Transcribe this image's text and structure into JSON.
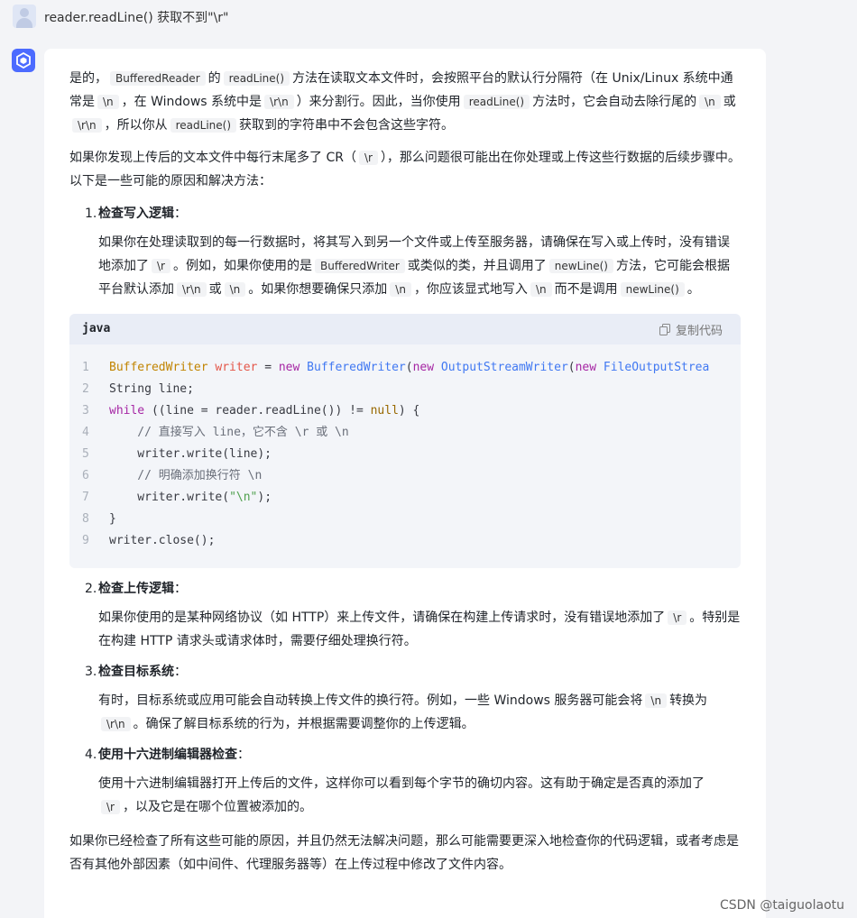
{
  "question": "reader.readLine() 获取不到\"\\r\"",
  "copy_label": "复制代码",
  "code_lang": "java",
  "p1": {
    "a": "是的，",
    "c1": "BufferedReader",
    "b": "的",
    "c2": "readLine()",
    "d": "方法在读取文本文件时，会按照平台的默认行分隔符（在 Unix/Linux 系统中通常是",
    "c3": "\\n",
    "e": "，在 Windows 系统中是",
    "c4": "\\r\\n",
    "f": "）来分割行。因此，当你使用",
    "c5": "readLine()",
    "g": "方法时，它会自动去除行尾的",
    "c6": "\\n",
    "h": "或",
    "c7": "\\r\\n",
    "i": "，所以你从",
    "c8": "readLine()",
    "j": "获取到的字符串中不会包含这些字符。"
  },
  "p2": {
    "a": "如果你发现上传后的文本文件中每行末尾多了 CR（",
    "c1": "\\r",
    "b": "），那么问题很可能出在你处理或上传这些行数据的后续步骤中。以下是一些可能的原因和解决方法："
  },
  "item1": {
    "num": "1.",
    "title": "检查写入逻辑",
    "a": "如果你在处理读取到的每一行数据时，将其写入到另一个文件或上传至服务器，请确保在写入或上传时，没有错误地添加了",
    "c1": "\\r",
    "b": "。例如，如果你使用的是",
    "c2": "BufferedWriter",
    "c": "或类似的类，并且调用了",
    "c3": "newLine()",
    "d": "方法，它可能会根据平台默认添加",
    "c4": "\\r\\n",
    "e": "或",
    "c5": "\\n",
    "f": "。如果你想要确保只添加",
    "c6": "\\n",
    "g": "，你应该显式地写入",
    "c7": "\\n",
    "h": "而不是调用",
    "c8": "newLine()",
    "i": "。"
  },
  "code_lines": [
    {
      "n": "1"
    },
    {
      "n": "2"
    },
    {
      "n": "3"
    },
    {
      "n": "4"
    },
    {
      "n": "5"
    },
    {
      "n": "6"
    },
    {
      "n": "7"
    },
    {
      "n": "8"
    },
    {
      "n": "9"
    }
  ],
  "code": {
    "l1_a": "BufferedWriter",
    "l1_b": " ",
    "l1_c": "writer",
    "l1_d": " = ",
    "l1_e": "new",
    "l1_f": " ",
    "l1_g": "BufferedWriter",
    "l1_h": "(",
    "l1_i": "new",
    "l1_j": " ",
    "l1_k": "OutputStreamWriter",
    "l1_l": "(",
    "l1_m": "new",
    "l1_n": " ",
    "l1_o": "FileOutputStrea",
    "l2": "String line;",
    "l3_a": "while",
    "l3_b": " ((line = reader.readLine()) != ",
    "l3_c": "null",
    "l3_d": ") {",
    "l4": "    // 直接写入 line，它不含 \\r 或 \\n",
    "l5": "    writer.write(line);",
    "l6": "    // 明确添加换行符 \\n",
    "l7_a": "    writer.write(",
    "l7_b": "\"\\n\"",
    "l7_c": ");",
    "l8": "}",
    "l9": "writer.close();"
  },
  "item2": {
    "num": "2.",
    "title": "检查上传逻辑",
    "a": "如果你使用的是某种网络协议（如 HTTP）来上传文件，请确保在构建上传请求时，没有错误地添加了",
    "c1": "\\r",
    "b": "。特别是在构建 HTTP 请求头或请求体时，需要仔细处理换行符。"
  },
  "item3": {
    "num": "3.",
    "title": "检查目标系统",
    "a": "有时，目标系统或应用可能会自动转换上传文件的换行符。例如，一些 Windows 服务器可能会将",
    "c1": "\\n",
    "b": "转换为",
    "c2": "\\r\\n",
    "c": "。确保了解目标系统的行为，并根据需要调整你的上传逻辑。"
  },
  "item4": {
    "num": "4.",
    "title": "使用十六进制编辑器检查",
    "a": "使用十六进制编辑器打开上传后的文件，这样你可以看到每个字节的确切内容。这有助于确定是否真的添加了",
    "c1": "\\r",
    "b": "，以及它是在哪个位置被添加的。"
  },
  "p3": "如果你已经检查了所有这些可能的原因，并且仍然无法解决问题，那么可能需要更深入地检查你的代码逻辑，或者考虑是否有其他外部因素（如中间件、代理服务器等）在上传过程中修改了文件内容。",
  "watermark": "CSDN @taiguolaotu"
}
